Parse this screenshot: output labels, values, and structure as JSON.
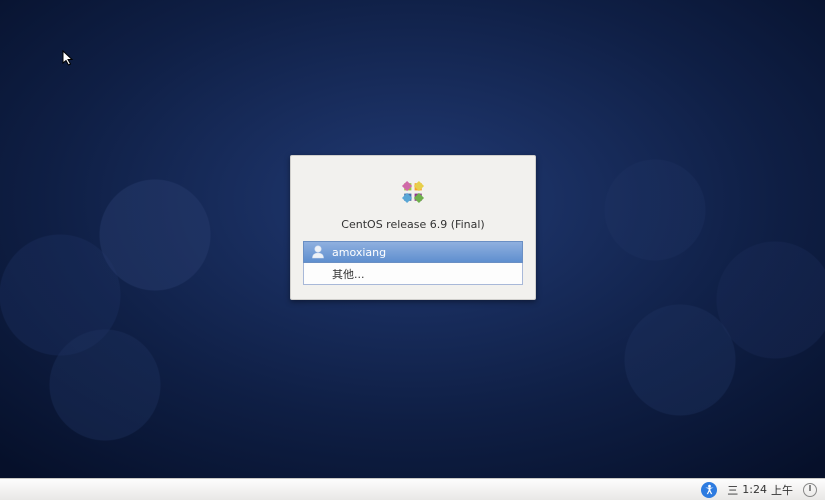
{
  "release": "CentOS release 6.9 (Final)",
  "users": {
    "selected": {
      "name": "amoxiang"
    },
    "other_label": "其他..."
  },
  "taskbar": {
    "day_of_week": "三",
    "time": "1:24",
    "ampm": "上午"
  }
}
